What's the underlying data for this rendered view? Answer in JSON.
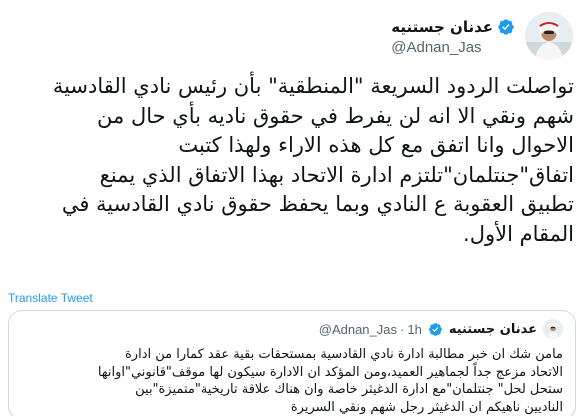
{
  "author": {
    "display_name": "عدنان جستنيه",
    "handle": "@Adnan_Jas",
    "avatar_icon": "profile-photo-icon",
    "verified_icon": "verified-badge-icon"
  },
  "tweet": {
    "text": "تواصلت الردود السريعة \"المنطقية\" بأن رئيس نادي القادسية\nشهم ونقي الا انه لن يفرط في حقوق ناديه بأي حال من\nالاحوال وانا اتفق مع كل هذه الاراء ولهذا كتبت\nاتفاق\"جنتلمان\"تلتزم ادارة الاتحاد بهذا الاتفاق الذي يمنع\nتطبيق العقوبة ع النادي وبما يحفظ حقوق نادي القادسية في\nالمقام الأول.",
    "translate_label": "Translate Tweet"
  },
  "quote": {
    "display_name": "عدنان جستنيه",
    "handle": "@Adnan_Jas",
    "separator": "·",
    "time": "1h",
    "text": "مامن شك ان خبر مطالبة ادارة نادي القادسية بمستحقات بقية عقد كمارا من ادارة\nالاتحاد مزعج جداً لجماهير العميد،ومن المؤكد ان الادارة سيكون لها موقف\"قانوني\"اوانها\nستحل لحل\" جنتلمان\"مع ادارة الدغيثر خاصة وان هناك علاقة تاريخية\"متميزة\"بين\nالناديين ناهيكم ان الدغيثر رجل شهم ونقي السريرة"
  },
  "colors": {
    "link": "#1d9bf0",
    "verified": "#1d9bf0",
    "secondary_text": "#536471",
    "border": "#cfd9de"
  }
}
